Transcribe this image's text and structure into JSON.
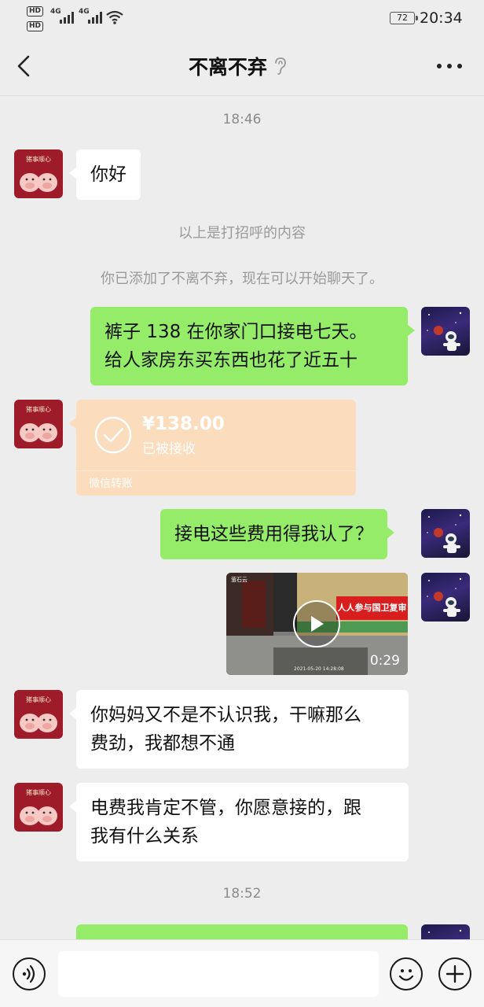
{
  "status_bar": {
    "hd1": "HD",
    "hd2": "HD",
    "net1": "4G",
    "net2": "4G",
    "battery": "72",
    "time": "20:34"
  },
  "header": {
    "title": "不离不弃",
    "back_icon": "back-chevron-icon",
    "ear_icon": "ear-icon",
    "more_icon": "more-dots-icon"
  },
  "messages": {
    "time1": "18:46",
    "greeting": "你好",
    "sys_greet": "以上是打招呼的内容",
    "sys_added": "你已添加了不离不弃，现在可以开始聊天了。",
    "out1_line1": "裤子 138  在你家门口接电七天。",
    "out1_line2": "给人家房东买东西也花了近五十",
    "transfer": {
      "amount": "¥138.00",
      "status": "已被接收",
      "label": "微信转账"
    },
    "out2": "接电这些费用得我认了？",
    "video": {
      "duration": "0:29",
      "banner": "人人参与国卫复审",
      "corner": "萤石云",
      "timestamp": "2021-05-20 14:28:08"
    },
    "in2_line1": "你妈妈又不是不认识我，干嘛那么",
    "in2_line2": "费劲，我都想不通",
    "in3_line1": "电费我肯定不管，你愿意接的，跟",
    "in3_line2": "我有什么关系",
    "time2": "18:52"
  },
  "composer": {
    "voice_icon": "voice-icon",
    "emoji_icon": "emoji-icon",
    "plus_icon": "plus-icon",
    "input_value": ""
  },
  "colors": {
    "sent_bubble": "#95ec69",
    "received_bubble": "#ffffff",
    "transfer_received": "#fbdcbd",
    "background": "#ededed"
  }
}
